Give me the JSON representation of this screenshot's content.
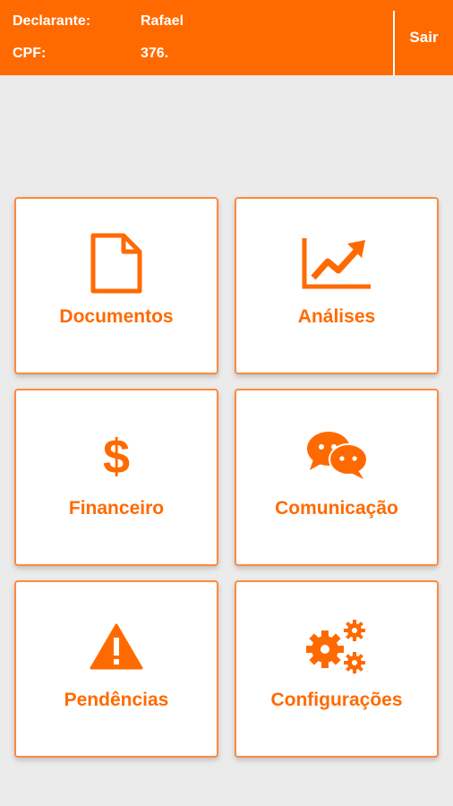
{
  "header": {
    "declarante_label": "Declarante:",
    "declarante_value": "Rafael",
    "cpf_label": "CPF:",
    "cpf_value": "376.",
    "logout_label": "Sair"
  },
  "tiles": [
    {
      "label": "Documentos",
      "icon": "document-icon"
    },
    {
      "label": "Análises",
      "icon": "trend-chart-icon"
    },
    {
      "label": "Financeiro",
      "icon": "dollar-icon"
    },
    {
      "label": "Comunicação",
      "icon": "chat-bubbles-icon"
    },
    {
      "label": "Pendências",
      "icon": "warning-icon"
    },
    {
      "label": "Configurações",
      "icon": "gears-icon"
    }
  ],
  "colors": {
    "accent": "#ff6a00",
    "background": "#ebebeb",
    "tile_border": "#ff8a3c"
  }
}
